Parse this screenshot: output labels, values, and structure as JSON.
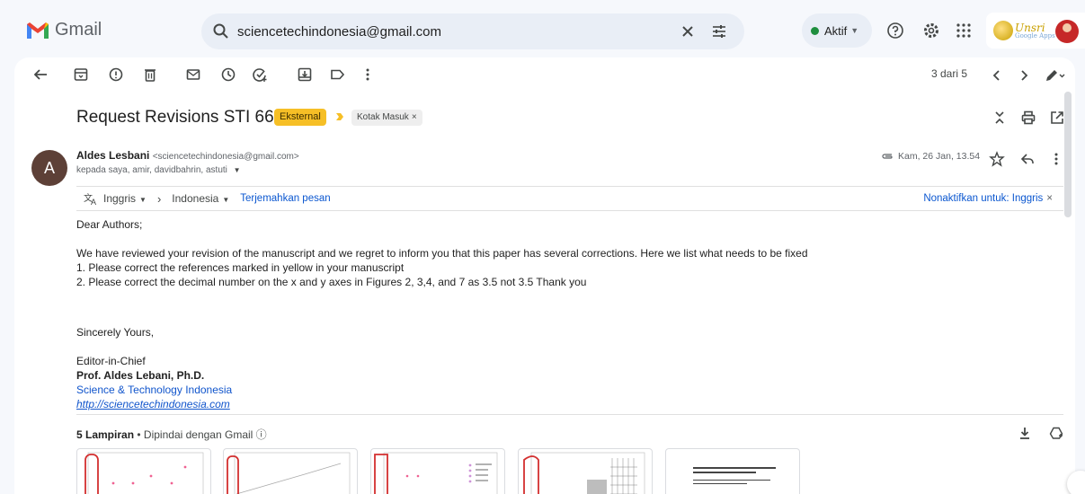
{
  "app": {
    "name": "Gmail"
  },
  "search": {
    "value": "sciencetechindonesia@gmail.com"
  },
  "status": {
    "label": "Aktif"
  },
  "account": {
    "logo_text": "Unsri",
    "logo_sub": "Google Apps"
  },
  "toolbar": {
    "pager": "3 dari 5"
  },
  "email": {
    "subject": "Request Revisions STI 662",
    "labels": {
      "external": "Eksternal",
      "inbox": "Kotak Masuk"
    },
    "sender_initial": "A",
    "sender_name": "Aldes Lesbani",
    "sender_email": "<sciencetechindonesia@gmail.com>",
    "recipients": "kepada saya, amir, davidbahrin, astuti",
    "date": "Kam, 26 Jan, 13.54",
    "translate": {
      "from": "Inggris",
      "to": "Indonesia",
      "action": "Terjemahkan pesan",
      "disable": "Nonaktifkan untuk: Inggris"
    },
    "body": {
      "greeting": "Dear Authors;",
      "line1": "We have reviewed your revision of the manuscript and we regret to inform you that this paper has several corrections. Here we list what needs to be fixed",
      "line2": "1. Please correct the references marked in yellow in your manuscript",
      "line3": "2. Please correct the decimal number on the x and y axes in Figures 2, 3,4, and 7 as 3.5 not 3.5 Thank you",
      "closing": "Sincerely Yours,",
      "role": "Editor-in-Chief",
      "signer": "Prof. Aldes Lebani, Ph.D.",
      "org": "Science & Technology Indonesia",
      "url": "http://sciencetechindonesia.com"
    },
    "attachments": {
      "count_label": "5 Lampiran",
      "scan_label": "Dipindai dengan Gmail"
    }
  },
  "colors": {
    "accent": "#0b57d0",
    "label_external": "#f6bf26",
    "online": "#1e8e3e",
    "avatar": "#5d4037"
  }
}
